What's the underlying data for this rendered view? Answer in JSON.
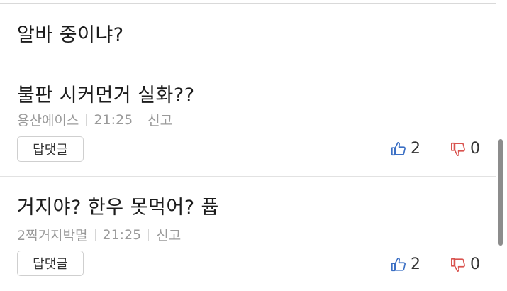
{
  "comments": [
    {
      "lines": [
        "알바 중이냐?",
        "불판 시커먼거 실화??"
      ],
      "author": "용산에이스",
      "time": "21:25",
      "report_label": "신고",
      "reply_label": "답댓글",
      "likes": "2",
      "dislikes": "0"
    },
    {
      "lines": [
        "거지야? 한우 못먹어? 퓹"
      ],
      "author": "2찍거지박멸",
      "time": "21:25",
      "report_label": "신고",
      "reply_label": "답댓글",
      "likes": "2",
      "dislikes": "0"
    }
  ],
  "colors": {
    "like": "#3b6fc4",
    "dislike": "#d9534f"
  },
  "icons": {
    "like": "thumbs-up-icon",
    "dislike": "thumbs-down-icon"
  }
}
